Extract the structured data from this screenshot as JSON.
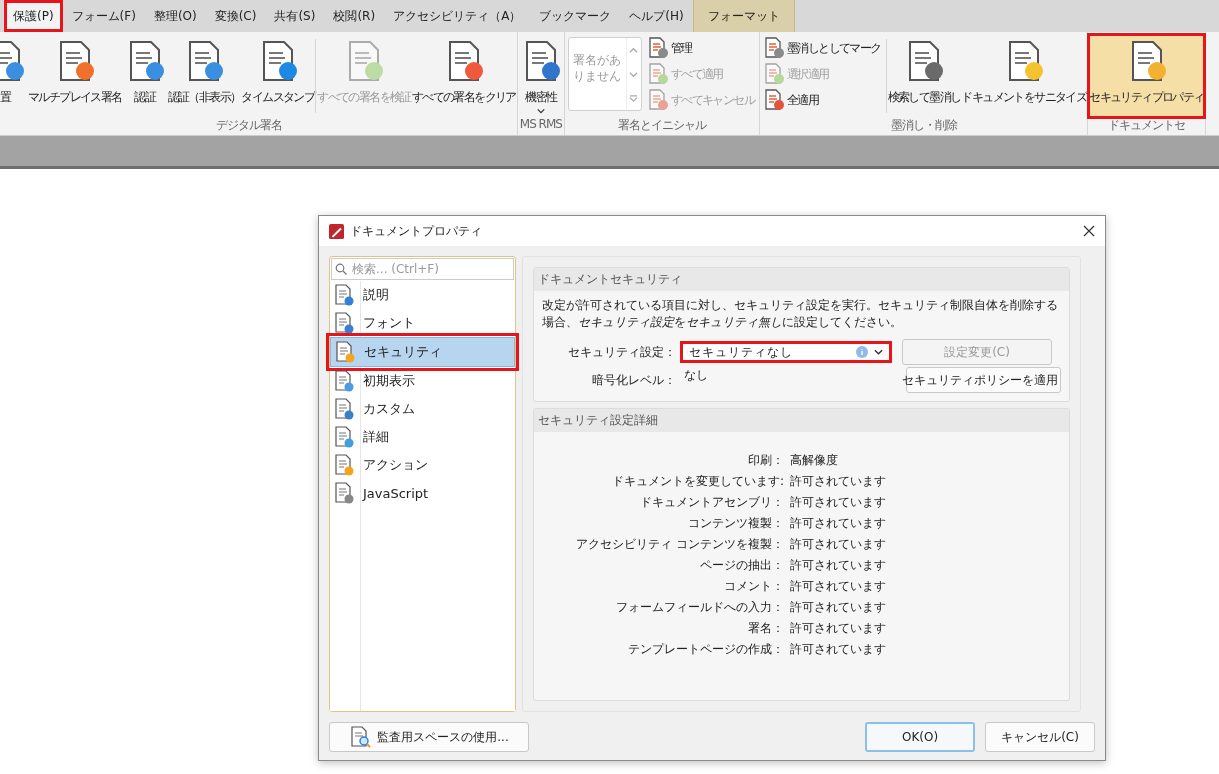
{
  "menu_tabs": [
    {
      "label": "保護(P)",
      "selected": true,
      "highlighted": true,
      "kind": "normal"
    },
    {
      "label": "フォーム(F)",
      "selected": false,
      "highlighted": false,
      "kind": "normal"
    },
    {
      "label": "整理(O)",
      "selected": false,
      "highlighted": false,
      "kind": "normal"
    },
    {
      "label": "変換(C)",
      "selected": false,
      "highlighted": false,
      "kind": "normal"
    },
    {
      "label": "共有(S)",
      "selected": false,
      "highlighted": false,
      "kind": "normal"
    },
    {
      "label": "校閲(R)",
      "selected": false,
      "highlighted": false,
      "kind": "normal"
    },
    {
      "label": "アクセシビリティ（A）",
      "selected": false,
      "highlighted": false,
      "kind": "normal"
    },
    {
      "label": "ブックマーク",
      "selected": false,
      "highlighted": false,
      "kind": "normal"
    },
    {
      "label": "ヘルプ(H)",
      "selected": false,
      "highlighted": false,
      "kind": "normal"
    },
    {
      "label": "フォーマット",
      "selected": false,
      "highlighted": false,
      "kind": "contextual"
    }
  ],
  "ribbon": {
    "groups": [
      {
        "label": "デジタル署名",
        "items": [
          {
            "kind": "large",
            "label": "置",
            "disabled": false,
            "selected": false,
            "highlighted": false
          },
          {
            "kind": "large",
            "label": "マルチプレイス署名",
            "disabled": false,
            "selected": false,
            "highlighted": false
          },
          {
            "kind": "large",
            "label": "認証",
            "disabled": false,
            "selected": false,
            "highlighted": false
          },
          {
            "kind": "large",
            "label": "認証（非表示）",
            "disabled": false,
            "selected": false,
            "highlighted": false
          },
          {
            "kind": "large",
            "label": "タイムスタンプ",
            "disabled": false,
            "selected": false,
            "highlighted": false
          },
          {
            "kind": "separator"
          },
          {
            "kind": "large",
            "label": "すべての署名を検証",
            "disabled": true,
            "selected": false,
            "highlighted": false
          },
          {
            "kind": "large",
            "label": "すべての署名をクリア",
            "disabled": false,
            "selected": false,
            "highlighted": false
          }
        ]
      },
      {
        "label": "MS RMS",
        "items": [
          {
            "kind": "large",
            "label": "機密性",
            "disabled": false,
            "selected": false,
            "highlighted": false,
            "dropdown": true
          }
        ]
      },
      {
        "label": "署名とイニシャル",
        "items": [
          {
            "kind": "listbox",
            "placeholder": "署名がありません"
          },
          {
            "kind": "small-stack",
            "buttons": [
              {
                "label": "管理",
                "disabled": false
              },
              {
                "label": "すべて適用",
                "disabled": true
              },
              {
                "label": "すべてキャンセル",
                "disabled": true
              }
            ]
          }
        ]
      },
      {
        "label": "墨消し・削除",
        "items": [
          {
            "kind": "small-stack",
            "buttons": [
              {
                "label": "墨消しとしてマーク",
                "disabled": false
              },
              {
                "label": "選択適用",
                "disabled": true
              },
              {
                "label": "全適用",
                "disabled": false
              }
            ]
          },
          {
            "kind": "separator"
          },
          {
            "kind": "large",
            "label": "検索して墨消し",
            "disabled": false,
            "selected": false,
            "highlighted": false
          },
          {
            "kind": "large",
            "label": "ドキュメントをサニタイズ",
            "disabled": false,
            "selected": false,
            "highlighted": false
          }
        ]
      },
      {
        "label": "ドキュメントセ",
        "items": [
          {
            "kind": "large",
            "label": "セキュリティプロパティ",
            "disabled": false,
            "selected": true,
            "highlighted": true
          }
        ]
      }
    ]
  },
  "dialog": {
    "title": "ドキュメントプロパティ",
    "search": {
      "placeholder": "検索... (Ctrl+F)"
    },
    "nav": [
      {
        "label": "説明",
        "selected": false,
        "highlighted": false
      },
      {
        "label": "フォント",
        "selected": false,
        "highlighted": false
      },
      {
        "label": "セキュリティ",
        "selected": true,
        "highlighted": true
      },
      {
        "label": "初期表示",
        "selected": false,
        "highlighted": false
      },
      {
        "label": "カスタム",
        "selected": false,
        "highlighted": false
      },
      {
        "label": "詳細",
        "selected": false,
        "highlighted": false
      },
      {
        "label": "アクション",
        "selected": false,
        "highlighted": false
      },
      {
        "label": "JavaScript",
        "selected": false,
        "highlighted": false
      }
    ],
    "security": {
      "heading": "ドキュメントセキュリティ",
      "description": [
        {
          "text": "改定が許可されている項目に対し、セキュリティ設定を実行。セキュリティ制限自体を削除する場合、",
          "italic": false
        },
        {
          "text": "セキュリティ設定",
          "italic": true
        },
        {
          "text": "を",
          "italic": false
        },
        {
          "text": "セキュリティ無し",
          "italic": true
        },
        {
          "text": "に設定してください。",
          "italic": false
        }
      ],
      "setting_label": "セキュリティ設定：",
      "setting_value": "セキュリティなし",
      "setting_highlighted": true,
      "change_button": {
        "label": "設定変更(C)",
        "disabled": true
      },
      "encryption_label": "暗号化レベル：",
      "encryption_value": "なし",
      "policy_button": "セキュリティポリシーを適用"
    },
    "details": {
      "heading": "セキュリティ設定詳細",
      "rows": [
        {
          "label": "印刷：",
          "value": "高解像度"
        },
        {
          "label": "ドキュメントを変更しています:",
          "value": "許可されています"
        },
        {
          "label": "ドキュメントアセンブリ：",
          "value": "許可されています"
        },
        {
          "label": "コンテンツ複製：",
          "value": "許可されています"
        },
        {
          "label": "アクセシビリティ コンテンツを複製：",
          "value": "許可されています"
        },
        {
          "label": "ページの抽出：",
          "value": "許可されています"
        },
        {
          "label": "コメント：",
          "value": "許可されています"
        },
        {
          "label": "フォームフィールドへの入力：",
          "value": "許可されています"
        },
        {
          "label": "署名：",
          "value": "許可されています"
        },
        {
          "label": "テンプレートページの作成：",
          "value": "許可されています"
        }
      ]
    },
    "buttons": {
      "audit": "監査用スペースの使用...",
      "ok": "OK(O)",
      "cancel": "キャンセル(C)"
    }
  }
}
